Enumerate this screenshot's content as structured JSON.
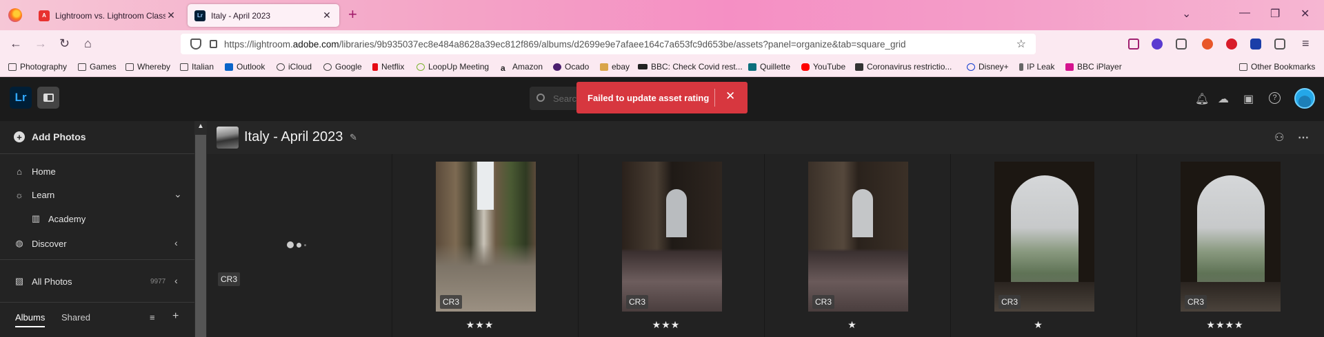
{
  "browser": {
    "tabs": [
      {
        "title": "Lightroom vs. Lightroom Classic",
        "favicon": "adobe-icon",
        "active": false
      },
      {
        "title": "Italy - April 2023",
        "favicon": "lr-icon",
        "active": true
      }
    ],
    "url": {
      "prefix": "https://lightroom.",
      "host": "adobe.com",
      "path": "/libraries/9b935037ec8e484a8628a39ec812f869/albums/d2699e9e7afaee164c7a653fc9d653be/assets?panel=organize&tab=square_grid"
    },
    "bookmarks": [
      "Photography",
      "Games",
      "Whereby",
      "Italian",
      "Outlook",
      "iCloud",
      "Google",
      "Netflix",
      "LoopUp Meeting",
      "Amazon",
      "Ocado",
      "ebay",
      "BBC: Check Covid rest...",
      "Quillette",
      "YouTube",
      "Coronavirus restrictio...",
      "Disney+",
      "IP Leak",
      "BBC iPlayer"
    ],
    "other_bookmarks": "Other Bookmarks"
  },
  "app": {
    "logo": "Lr",
    "search_placeholder": "Search",
    "toast": {
      "message": "Failed to update asset rating",
      "color": "#d7373f"
    },
    "sidebar": {
      "add_photos": "Add Photos",
      "home": "Home",
      "learn": "Learn",
      "academy": "Academy",
      "discover": "Discover",
      "all_photos": "All Photos",
      "all_photos_count": "9977",
      "tabs": {
        "albums": "Albums",
        "shared": "Shared"
      }
    },
    "album": {
      "title": "Italy - April 2023"
    },
    "grid": [
      {
        "badge": "CR3",
        "rating": 0,
        "loading": true
      },
      {
        "badge": "CR3",
        "rating": 3,
        "stars": "★★★"
      },
      {
        "badge": "CR3",
        "rating": 3,
        "stars": "★★★"
      },
      {
        "badge": "CR3",
        "rating": 1,
        "stars": "★"
      },
      {
        "badge": "CR3",
        "rating": 1,
        "stars": "★"
      },
      {
        "badge": "CR3",
        "rating": 4,
        "stars": "★★★★"
      }
    ]
  }
}
